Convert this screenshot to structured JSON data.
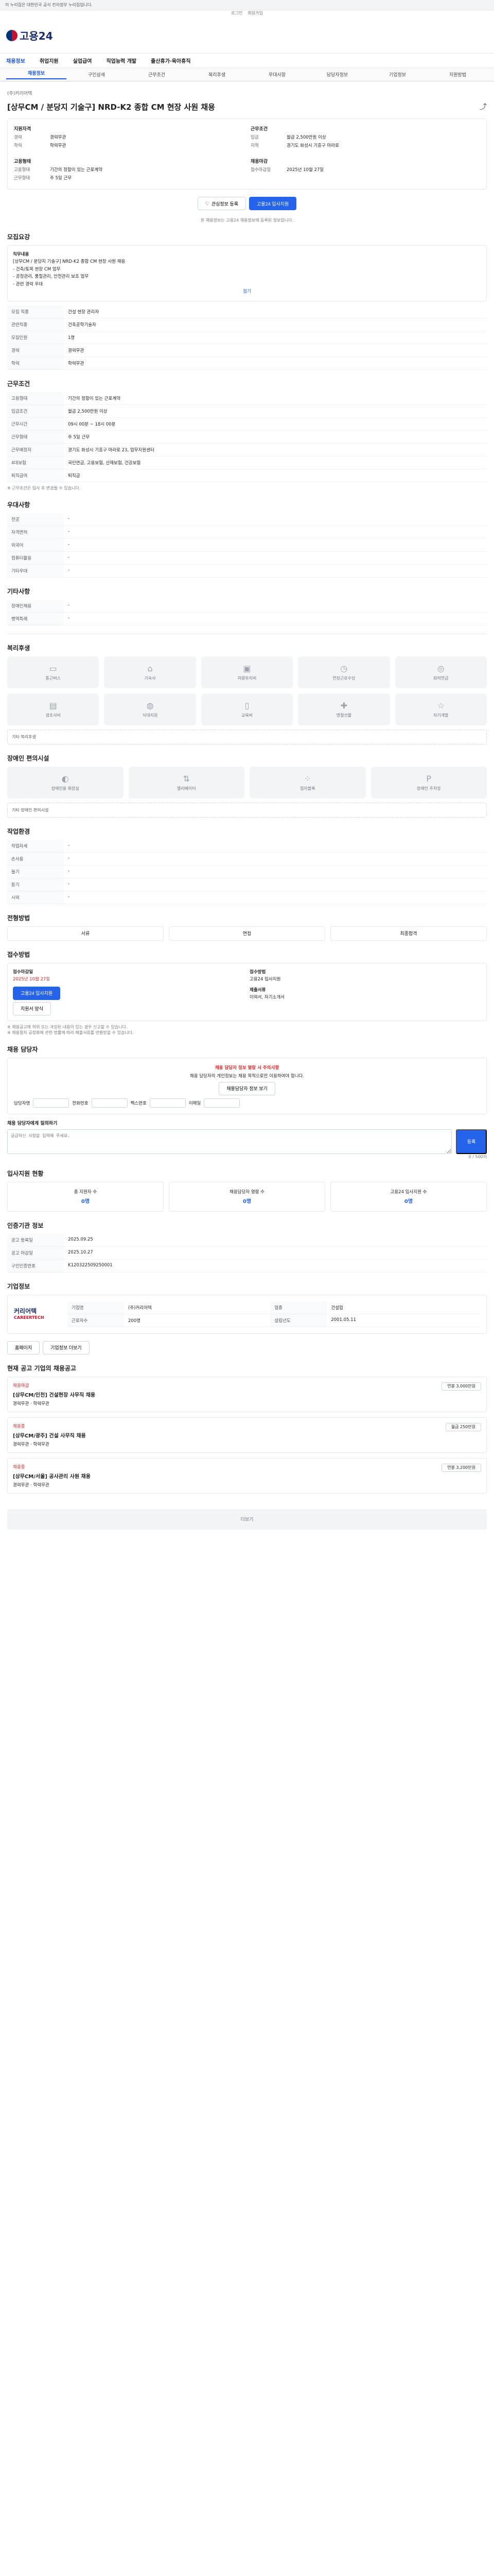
{
  "topbar": {
    "notice": "이 누리집은 대한민국 공식 전자정부 누리집입니다."
  },
  "util": {
    "login": "로그인",
    "join": "회원가입"
  },
  "header": {
    "logo": "고용24"
  },
  "gnb": [
    "채용정보",
    "취업지원",
    "실업급여",
    "직업능력 개발",
    "출산휴가·육아휴직"
  ],
  "tabs": [
    "채용정보",
    "구인상세",
    "근무조건",
    "복리후생",
    "우대사항",
    "담당자정보",
    "기업정보",
    "지원방법"
  ],
  "job": {
    "company_label": "(주)커리어텍",
    "title": "[상무CM / 분당지 기술구] NRD-K2 종합 CM 현장 사원 채용",
    "summary": [
      {
        "group": "지원자격",
        "items": [
          {
            "k": "경력",
            "v": "경력무관"
          },
          {
            "k": "학력",
            "v": "학력무관"
          }
        ]
      },
      {
        "group": "근무조건",
        "items": [
          {
            "k": "임금",
            "v": "월급 2,500만원 이상"
          },
          {
            "k": "지역",
            "v": "경기도 화성시 기흥구 마라로"
          }
        ]
      },
      {
        "group": "고용형태",
        "items": [
          {
            "k": "고용형태",
            "v": "기간의 정함이 있는 근로계약"
          },
          {
            "k": "근무형태",
            "v": "주 5일 근무"
          }
        ]
      },
      {
        "group": "채용마감",
        "items": [
          {
            "k": "접수마감일",
            "v": "2025년 10월 27일"
          }
        ]
      }
    ],
    "btn_interest": "관심정보 등록",
    "btn_apply": "고용24 입사지원",
    "notice": "본 채용정보는 고용24 채용정보에 등록된 정보입니다."
  },
  "recruit": {
    "title": "모집요강",
    "box_title": "직무내용",
    "box_lines": [
      "[상무CM / 분당지 기술구] NRD-K2 종합 CM 현장 사원 채용",
      "- 건축/토목 현장 CM 업무",
      "- 공정관리, 품질관리, 안전관리 보조 업무",
      "- 관련 경력 우대"
    ],
    "toggle": "접기",
    "rows": [
      {
        "k": "모집 직종",
        "v": "건설 현장 관리자"
      },
      {
        "k": "관련직종",
        "v": "건축공학기술자"
      },
      {
        "k": "모집인원",
        "v": "1명"
      },
      {
        "k": "경력",
        "v": "경력무관"
      },
      {
        "k": "학력",
        "v": "학력무관"
      }
    ]
  },
  "conditions": {
    "title": "근무조건",
    "rows": [
      {
        "k": "고용형태",
        "v": "기간의 정함이 있는 근로계약"
      },
      {
        "k": "임금조건",
        "v": "월급 2,500만원 이상"
      },
      {
        "k": "근무시간",
        "v": "09시 00분 ~ 18시 00분"
      },
      {
        "k": "근무형태",
        "v": "주 5일 근무"
      },
      {
        "k": "근무예정지",
        "v": "경기도 화성시 기흥구 마라로 23, 업무지원센터"
      },
      {
        "k": "4대보험",
        "v": "국민연금, 고용보험, 산재보험, 건강보험"
      },
      {
        "k": "퇴직급여",
        "v": "퇴직금"
      }
    ],
    "note": "※ 근무조건은 입사 후 변경될 수 있습니다."
  },
  "prefer": {
    "title": "우대사항",
    "rows": [
      {
        "k": "전공",
        "v": "-"
      },
      {
        "k": "자격면허",
        "v": "-"
      },
      {
        "k": "외국어",
        "v": "-"
      },
      {
        "k": "컴퓨터활용",
        "v": "-"
      },
      {
        "k": "기타우대",
        "v": "-"
      }
    ]
  },
  "other": {
    "title": "기타사항",
    "rows": [
      {
        "k": "장애인채용",
        "v": "-"
      },
      {
        "k": "병역특례",
        "v": "-"
      }
    ]
  },
  "welfare": {
    "title": "복리후생",
    "cards": [
      "통근버스",
      "기숙사",
      "차량유지비",
      "연장근로수당",
      "퇴직연금",
      "경조사비",
      "식대지원",
      "교육비",
      "명절선물",
      "자기개발"
    ],
    "extra_label": "기타 복리후생"
  },
  "disabled": {
    "title": "장애인 편의시설",
    "cards": [
      "장애인용 화장실",
      "엘리베이터",
      "점자블록",
      "장애인 주차장"
    ],
    "extra_label": "기타 장애인 편의시설"
  },
  "workenv": {
    "title": "작업환경",
    "rows": [
      {
        "k": "작업자세",
        "v": "-"
      },
      {
        "k": "손사용",
        "v": "-"
      },
      {
        "k": "들기",
        "v": "-"
      },
      {
        "k": "듣기",
        "v": "-"
      },
      {
        "k": "시력",
        "v": "-"
      }
    ]
  },
  "selection": {
    "title": "전형방법",
    "steps": [
      "서류",
      "면접",
      "최종합격"
    ]
  },
  "apply": {
    "title": "접수방법",
    "deadline_label": "접수마감일",
    "deadline": "2025년 10월 27일",
    "methods_label": "접수방법",
    "methods": "고용24 입사지원",
    "docs_label": "제출서류",
    "docs": "이력서, 자기소개서",
    "btn_apply": "고용24 입사지원",
    "btn_form": "지원서 양식",
    "notes": [
      "※ 채용공고에 허위 또는 과장된 내용이 있는 경우 신고할 수 있습니다.",
      "※ 채용절차 공정화에 관한 법률에 따라 제출서류를 반환받을 수 있습니다."
    ]
  },
  "manager": {
    "title": "채용 담당자",
    "warn": "채용 담당자 정보 열람 시 주의사항",
    "warn_text": "채용 담당자의 개인정보는 채용 목적으로만 이용하여야 합니다.",
    "view_btn": "채용담당자 정보 보기",
    "name_label": "담당자명",
    "tel_label": "전화번호",
    "fax_label": "팩스번호",
    "email_label": "이메일",
    "memo_title": "채용 담당자에게 질의하기",
    "memo_placeholder": "궁금하신 사항을 입력해 주세요.",
    "memo_count": "0 / 500자",
    "save": "등록"
  },
  "stats": {
    "title": "입사지원 현황",
    "cards": [
      {
        "label": "총 지원자 수",
        "value": "0명"
      },
      {
        "label": "채용담당자 열람 수",
        "value": "0명"
      },
      {
        "label": "고용24 입사지원 수",
        "value": "0명"
      }
    ]
  },
  "info": {
    "title": "인증기관 정보",
    "rows": [
      {
        "k": "공고 등록일",
        "v": "2025.09.25"
      },
      {
        "k": "공고 마감일",
        "v": "2025.10.27"
      },
      {
        "k": "구인인증번호",
        "v": "K120322509250001"
      }
    ]
  },
  "company": {
    "title": "기업정보",
    "logo_text": "커리어텍",
    "logo_sub": "CAREERTECH",
    "rows": [
      {
        "k": "기업명",
        "v": "(주)커리어텍"
      },
      {
        "k": "업종",
        "v": "건설업"
      },
      {
        "k": "근로자수",
        "v": "200명"
      },
      {
        "k": "설립년도",
        "v": "2001.05.11"
      }
    ],
    "btn_home": "홈페이지",
    "btn_more": "기업정보 더보기"
  },
  "related": {
    "title": "현재 공고 기업의 채용공고",
    "items": [
      {
        "badge": "채용마감",
        "name": "[상무CM/인천] 건설현장 사무직 채용",
        "meta": "경력무관 · 학력무관",
        "pay": "연봉 3,000만원"
      },
      {
        "badge": "채용중",
        "name": "[상무CM/광주] 건설 사무직 채용",
        "meta": "경력무관 · 학력무관",
        "pay": "월급 250만원"
      },
      {
        "badge": "채용중",
        "name": "[상무CM/서울] 공사관리 사원 채용",
        "meta": "경력무관 · 학력무관",
        "pay": "연봉 3,200만원"
      }
    ],
    "more_btn": "더보기"
  },
  "footer": {
    "text": "더보기"
  }
}
